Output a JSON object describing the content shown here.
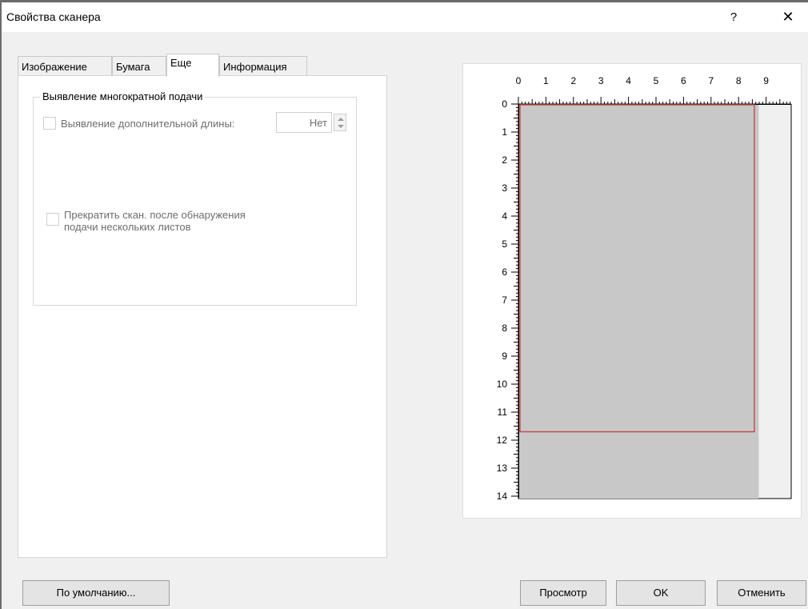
{
  "window": {
    "title": "Свойства сканера",
    "help_label": "?",
    "close_label": "✕"
  },
  "tabs": [
    {
      "label": "Изображение",
      "active": false
    },
    {
      "label": "Бумага",
      "active": false
    },
    {
      "label": "Еще",
      "active": true
    },
    {
      "label": "Информация",
      "active": false
    }
  ],
  "multifeed_group": {
    "title": "Выявление многократной подачи",
    "length_detection_label": "Выявление дополнительной длины:",
    "length_detection_checked": false,
    "length_value": "Нет",
    "stop_scan_label_line1": "Прекратить скан. после обнаружения",
    "stop_scan_label_line2": "подачи нескольких листов",
    "stop_scan_checked": false
  },
  "preview": {
    "x_ticks": [
      "0",
      "1",
      "2",
      "3",
      "4",
      "5",
      "6",
      "7",
      "8",
      "9"
    ],
    "y_ticks": [
      "0",
      "1",
      "2",
      "3",
      "4",
      "5",
      "6",
      "7",
      "8",
      "9",
      "10",
      "11",
      "12",
      "13",
      "14"
    ],
    "page_width_in": 8.5,
    "page_height_in": 14,
    "scan_area_width_in": 8.5,
    "scan_area_height_in": 11.7,
    "colors": {
      "page_fill": "#c8c8c8",
      "outside_fill": "#f0f0f0",
      "selection_border": "#c0504d"
    }
  },
  "buttons": {
    "defaults": "По умолчанию...",
    "preview": "Просмотр",
    "ok": "OK",
    "cancel": "Отменить"
  }
}
